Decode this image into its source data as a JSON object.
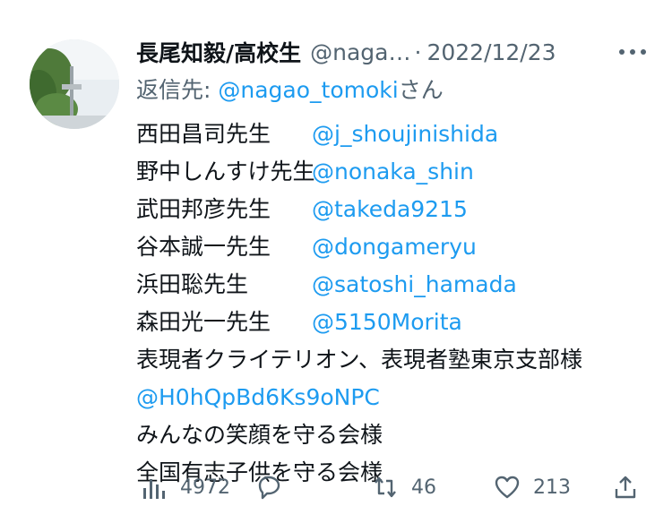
{
  "tweet": {
    "author": {
      "display_name": "長尾知毅/高校生",
      "handle": "@naga…",
      "avatar_icon": "avatar-photo"
    },
    "separator": "·",
    "date": "2022/12/23",
    "more_icon": "more-horizontal-icon",
    "reply": {
      "prefix": "返信先: ",
      "handle": "@nagao_tomoki",
      "suffix": "さん"
    },
    "lines": [
      {
        "name": "西田昌司先生",
        "mention": "@j_shoujinishida"
      },
      {
        "name": "野中しんすけ先生",
        "mention": "@nonaka_shin"
      },
      {
        "name": "武田邦彦先生",
        "mention": "@takeda9215"
      },
      {
        "name": "谷本誠一先生",
        "mention": "@dongameryu"
      },
      {
        "name": "浜田聡先生",
        "mention": "@satoshi_hamada"
      },
      {
        "name": "森田光一先生",
        "mention": "@5150Morita"
      }
    ],
    "text_line_7": "表現者クライテリオン、表現者塾東京支部様",
    "mention_line_8": "@H0hQpBd6Ks9oNPC",
    "text_line_9": "みんなの笑顔を守る会様",
    "text_line_10": "全国有志子供を守る会様",
    "actions": {
      "views": {
        "icon": "analytics-icon",
        "count": "4972"
      },
      "reply": {
        "icon": "reply-icon",
        "count": ""
      },
      "retweet": {
        "icon": "retweet-icon",
        "count": "46"
      },
      "like": {
        "icon": "like-icon",
        "count": "213"
      },
      "share": {
        "icon": "share-icon",
        "count": ""
      }
    },
    "colors": {
      "link": "#1d9bf0",
      "muted": "#536471",
      "text": "#0f1419"
    }
  }
}
